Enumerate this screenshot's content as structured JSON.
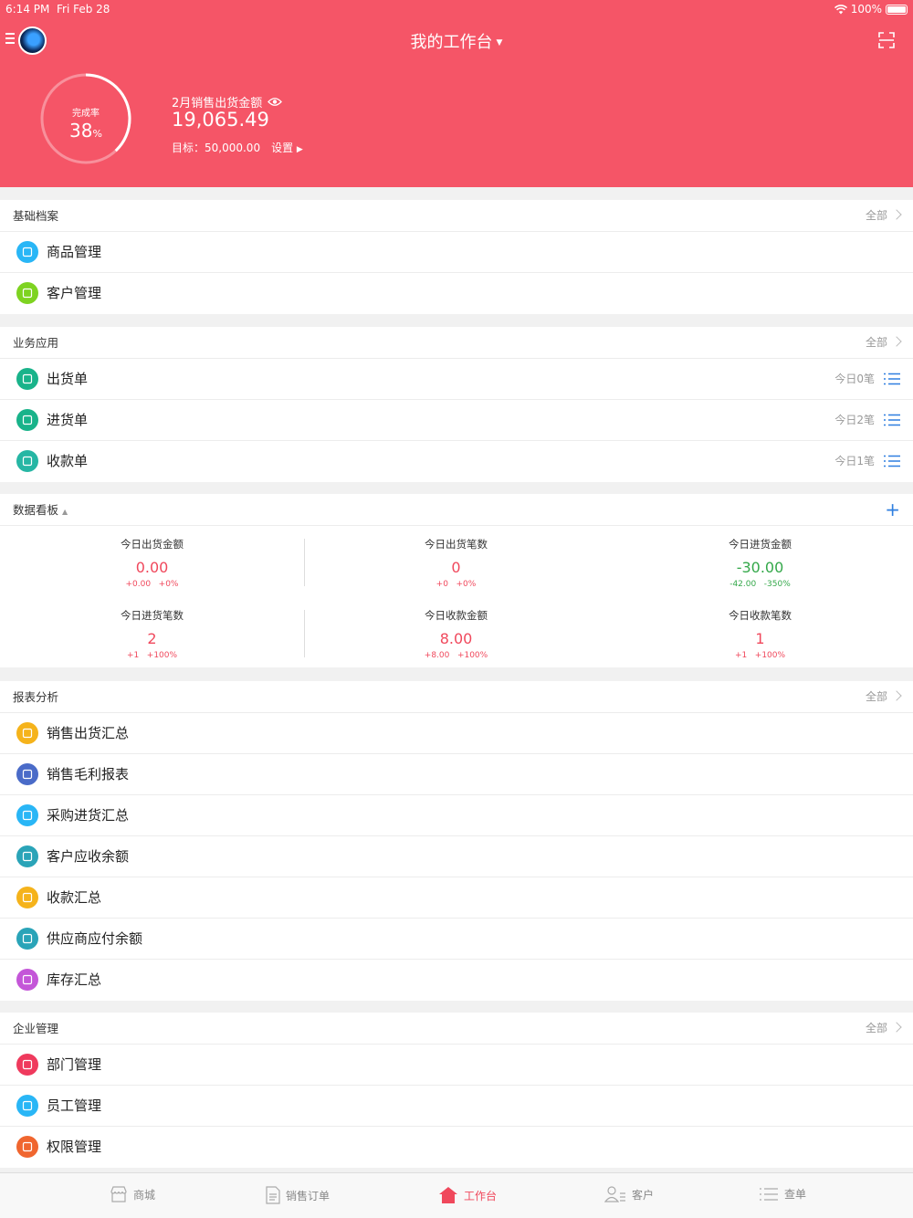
{
  "status": {
    "time": "6:14 PM",
    "date": "Fri Feb 28",
    "battery": "100%"
  },
  "header": {
    "title": "我的工作台",
    "ring_label": "完成率",
    "ring_value": "38",
    "ring_unit": "%",
    "completion_fraction": 0.38,
    "sales_label": "2月销售出货金额",
    "sales_amount": "19,065.49",
    "target_text": "目标：50,000.00",
    "settings_label": "设置"
  },
  "sections": {
    "basic": {
      "title": "基础档案",
      "all": "全部",
      "items": [
        {
          "label": "商品管理",
          "icon": "cube-icon",
          "color": "#29b6f6"
        },
        {
          "label": "客户管理",
          "icon": "customer-icon",
          "color": "#7ed321"
        }
      ]
    },
    "business": {
      "title": "业务应用",
      "all": "全部",
      "items": [
        {
          "label": "出货单",
          "count": "今日0笔",
          "icon": "outbound-icon",
          "color": "#19b38a"
        },
        {
          "label": "进货单",
          "count": "今日2笔",
          "icon": "inbound-icon",
          "color": "#19b38a"
        },
        {
          "label": "收款单",
          "count": "今日1笔",
          "icon": "receipt-icon",
          "color": "#26b6a4"
        }
      ]
    },
    "dashboard": {
      "title": "数据看板",
      "cells": [
        {
          "title": "今日出货金额",
          "value": "0.00",
          "delta": "+0.00   +0%",
          "tone": "red"
        },
        {
          "title": "今日出货笔数",
          "value": "0",
          "delta": "+0   +0%",
          "tone": "red"
        },
        {
          "title": "今日进货金额",
          "value": "-30.00",
          "delta": "-42.00   -350%",
          "tone": "green"
        },
        {
          "title": "今日进货笔数",
          "value": "2",
          "delta": "+1   +100%",
          "tone": "red"
        },
        {
          "title": "今日收款金额",
          "value": "8.00",
          "delta": "+8.00   +100%",
          "tone": "red"
        },
        {
          "title": "今日收款笔数",
          "value": "1",
          "delta": "+1   +100%",
          "tone": "red"
        }
      ]
    },
    "reports": {
      "title": "报表分析",
      "all": "全部",
      "items": [
        {
          "label": "销售出货汇总",
          "icon": "trend-icon",
          "color": "#f5b31b"
        },
        {
          "label": "销售毛利报表",
          "icon": "bar-chart-icon",
          "color": "#4a6bc8"
        },
        {
          "label": "采购进货汇总",
          "icon": "bag-icon",
          "color": "#29b6f6"
        },
        {
          "label": "客户应收余额",
          "icon": "yen-icon",
          "color": "#2aa4b8"
        },
        {
          "label": "收款汇总",
          "icon": "collect-icon",
          "color": "#f5b31b"
        },
        {
          "label": "供应商应付余额",
          "icon": "payable-icon",
          "color": "#2aa4b8"
        },
        {
          "label": "库存汇总",
          "icon": "box-icon",
          "color": "#c456d8"
        }
      ]
    },
    "enterprise": {
      "title": "企业管理",
      "all": "全部",
      "items": [
        {
          "label": "部门管理",
          "icon": "org-icon",
          "color": "#ef3a5d"
        },
        {
          "label": "员工管理",
          "icon": "id-card-icon",
          "color": "#29b6f6"
        },
        {
          "label": "权限管理",
          "icon": "key-icon",
          "color": "#f0662f"
        }
      ]
    }
  },
  "tabs": [
    {
      "label": "商城",
      "icon": "store-icon"
    },
    {
      "label": "销售订单",
      "icon": "order-icon"
    },
    {
      "label": "工作台",
      "icon": "home-icon"
    },
    {
      "label": "客户",
      "icon": "customer-tab-icon"
    },
    {
      "label": "查单",
      "icon": "list-tab-icon"
    }
  ],
  "colors": {
    "brand": "#f55567",
    "accent_blue": "#2f7fe0",
    "positive": "#34a84a",
    "negative": "#f0485c"
  }
}
